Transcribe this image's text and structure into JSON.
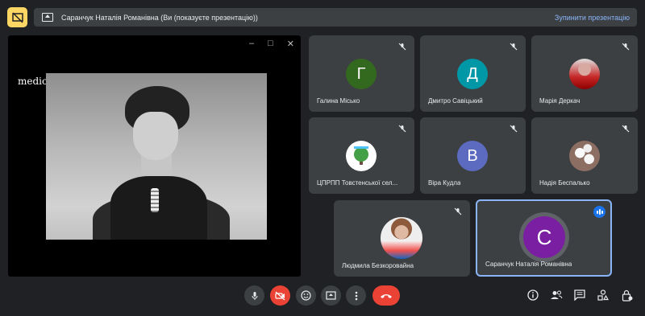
{
  "banner": {
    "title": "Саранчук Наталія Романівна (Ви (показуєте презентацію))",
    "stop_label": "Зупинити презентацію"
  },
  "stage": {
    "logo": "medici.tv",
    "window_controls": [
      "–",
      "□",
      "✕"
    ]
  },
  "participants": [
    {
      "name": "Галина Місько",
      "initial": "Г",
      "color": "#33691e",
      "muted": true
    },
    {
      "name": "Дмитро Савіцький",
      "initial": "Д",
      "color": "#0097a7",
      "muted": true
    },
    {
      "name": "Марія Деркач",
      "initial": "",
      "muted": true
    },
    {
      "name": "ЦПРПП Товстенської сел...",
      "initial": "",
      "muted": true
    },
    {
      "name": "Віра Кудла",
      "initial": "В",
      "color": "#5c6bc0",
      "muted": true
    },
    {
      "name": "Надія Беспалько",
      "initial": "",
      "muted": true
    },
    {
      "name": "Людмила Безкоровайна",
      "initial": "",
      "muted": true
    },
    {
      "name": "Саранчук Наталія Романівна",
      "initial": "С",
      "color": "#7b1fa2",
      "speaking": true
    }
  ],
  "controls": {
    "left": [
      "mic-icon",
      "camera-off-icon",
      "emoji-icon",
      "present-icon",
      "more-icon",
      "end-call-icon"
    ],
    "right": [
      "info-icon",
      "people-icon",
      "chat-icon",
      "activities-icon",
      "host-controls-icon"
    ]
  }
}
